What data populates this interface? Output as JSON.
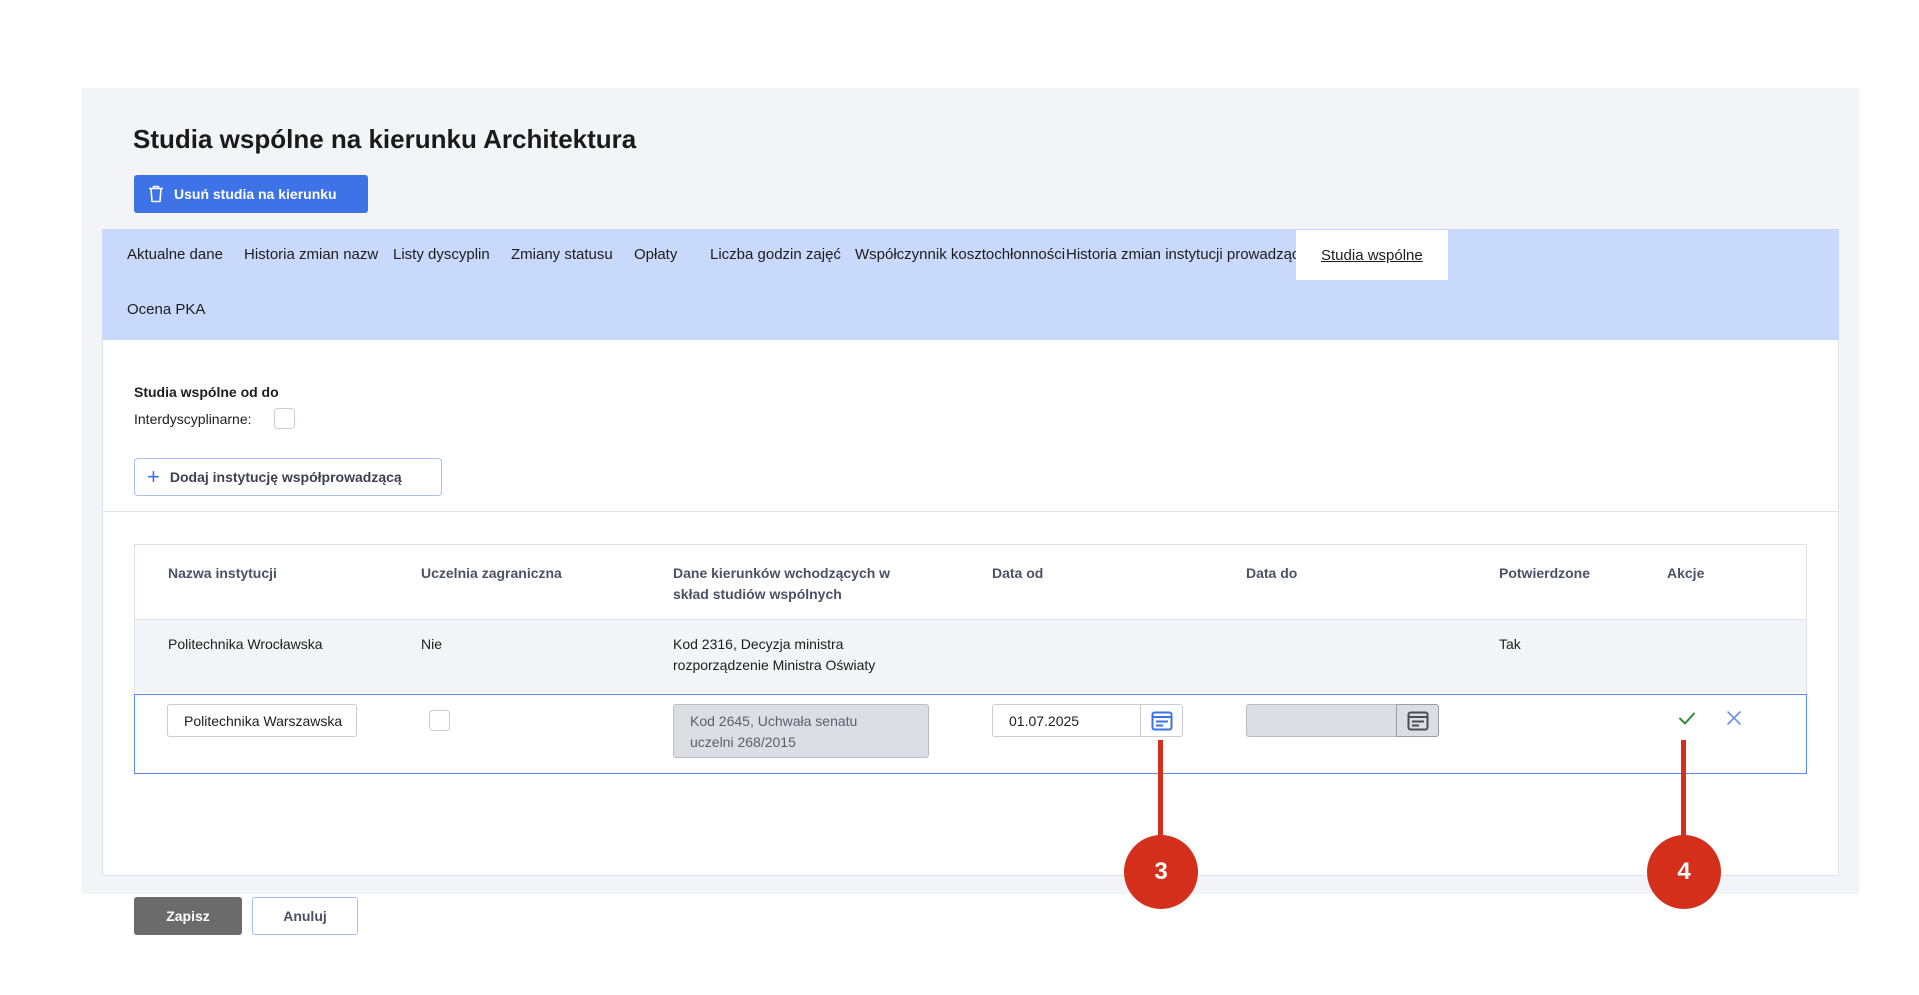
{
  "page": {
    "title": "Studia wspólne na kierunku Architektura",
    "delete_button": "Usuń studia na kierunku"
  },
  "tabs": [
    {
      "label": "Aktualne dane"
    },
    {
      "label": "Historia zmian nazw"
    },
    {
      "label": "Listy dyscyplin"
    },
    {
      "label": "Zmiany statusu"
    },
    {
      "label": "Opłaty"
    },
    {
      "label": "Liczba godzin zajęć"
    },
    {
      "label": "Współczynnik kosztochłonności"
    },
    {
      "label": "Historia zmian instytucji prowadzącej studia"
    },
    {
      "label": "Studia wspólne",
      "active": true
    },
    {
      "label": "Ocena PKA"
    }
  ],
  "form": {
    "section_label": "Studia wspólne od do",
    "interdisciplinary_label": "Interdyscyplinarne:",
    "interdisciplinary_checked": false,
    "add_button": "Dodaj instytucję współprowadzącą"
  },
  "table": {
    "headers": {
      "name": "Nazwa instytucji",
      "foreign": "Uczelnia zagraniczna",
      "dane_line1": "Dane kierunków wchodzących w",
      "dane_line2": "skład studiów wspólnych",
      "date_from": "Data od",
      "date_to": "Data do",
      "confirmed": "Potwierdzone",
      "actions": "Akcje"
    },
    "row1": {
      "name": "Politechnika Wrocławska",
      "foreign": "Nie",
      "dane_line1": "Kod 2316, Decyzja ministra",
      "dane_line2": "rozporządzenie Ministra Oświaty",
      "date_from": "",
      "date_to": "",
      "confirmed": "Tak"
    },
    "edit_row": {
      "name_value": "Politechnika Warszawska",
      "foreign_checked": false,
      "dane_line1": "Kod 2645,  Uchwała senatu",
      "dane_line2": "uczelni 268/2015",
      "date_from_value": "01.07.2025",
      "date_to_value": ""
    }
  },
  "footer": {
    "save_button": "Zapisz",
    "cancel_button": "Anuluj"
  },
  "callouts": {
    "c3": "3",
    "c4": "4"
  },
  "colors": {
    "primary": "#3d73e6",
    "tabbar": "#c9d9fb",
    "callout": "#d32f1a",
    "confirm_check": "#2e8b3a",
    "cancel_x": "#6d8fe0"
  }
}
